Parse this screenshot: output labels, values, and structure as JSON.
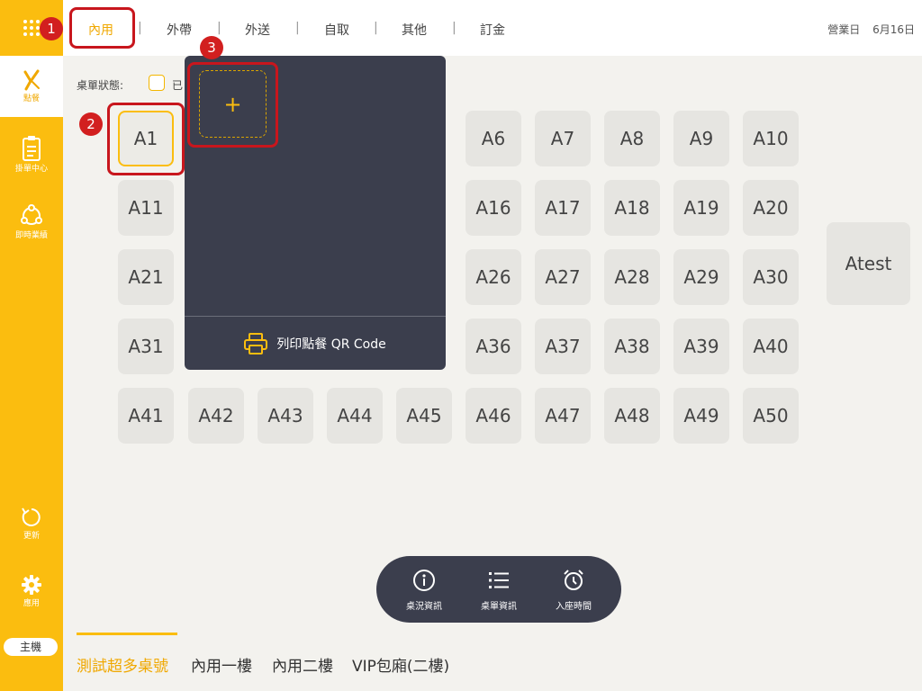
{
  "sidebar": {
    "items": [
      {
        "label": "點餐",
        "icon": "order-icon"
      },
      {
        "label": "掛單中心",
        "icon": "clipboard-icon"
      },
      {
        "label": "即時業績",
        "icon": "realtime-icon"
      },
      {
        "label": "更新",
        "icon": "refresh-icon"
      },
      {
        "label": "應用",
        "icon": "gear-icon"
      }
    ],
    "host": "主機"
  },
  "tabs": [
    "內用",
    "外帶",
    "外送",
    "自取",
    "其他",
    "訂金"
  ],
  "active_tab": "內用",
  "business_day": {
    "label": "營業日",
    "date": "6月16日"
  },
  "status": {
    "label": "桌單狀態:",
    "text": "已"
  },
  "tables": {
    "row1": [
      "A1",
      "A6",
      "A7",
      "A8",
      "A9",
      "A10"
    ],
    "row2": [
      "A11",
      "A16",
      "A17",
      "A18",
      "A19",
      "A20"
    ],
    "row3": [
      "A21",
      "A26",
      "A27",
      "A28",
      "A29",
      "A30"
    ],
    "row4": [
      "A31",
      "A36",
      "A37",
      "A38",
      "A39",
      "A40"
    ],
    "row5": [
      "A41",
      "A42",
      "A43",
      "A44",
      "A45",
      "A46",
      "A47",
      "A48",
      "A49",
      "A50"
    ],
    "special": "Atest"
  },
  "popup": {
    "add_symbol": "+",
    "print_label": "列印點餐 QR Code"
  },
  "callouts": [
    "1",
    "2",
    "3"
  ],
  "actions": [
    {
      "label": "桌況資訊",
      "icon": "info-icon"
    },
    {
      "label": "桌單資訊",
      "icon": "list-icon"
    },
    {
      "label": "入座時間",
      "icon": "alarm-clock-icon"
    }
  ],
  "floors": [
    "測試超多桌號",
    "內用一樓",
    "內用二樓",
    "VIP包廂(二樓)"
  ],
  "colors": {
    "accent": "#fbbd0f",
    "dark": "#3b3e4d",
    "callout": "#d21f1f"
  }
}
